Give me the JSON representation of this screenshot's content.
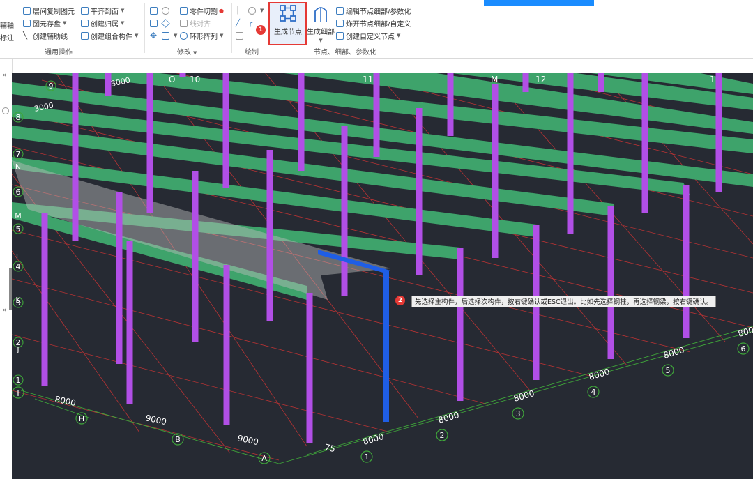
{
  "ribbon": {
    "general_ops": {
      "title": "通用操作",
      "left_cut_1": "辅轴",
      "left_cut_2": "标注",
      "layer_copy": "层间复制图元",
      "element_save": "图元存盘",
      "create_aux_line": "创建辅助线",
      "align_to_face": "平齐到面",
      "create_group": "创建归属",
      "create_combo": "创建组合构件"
    },
    "modify": {
      "title": "修改",
      "part_cut": "零件切割",
      "line_align": "线对齐",
      "ring_array": "环形阵列"
    },
    "draw": {
      "title": "绘制"
    },
    "node": {
      "title": "节点、细部、参数化",
      "gen_node": "生成节点",
      "gen_detail": "生成细部",
      "edit_node": "编辑节点细部/参数化",
      "explode_node": "炸开节点细部/自定义",
      "create_custom": "创建自定义节点"
    }
  },
  "steps": {
    "step1": "1",
    "step2": "2"
  },
  "tooltip": "先选择主构件，后选择次构件，按右键确认或ESC退出。比如先选择钢柱，再选择钢梁，按右键确认。",
  "colors": {
    "beam": "#3ea36b",
    "column": "#b14fe6",
    "selected": "#1f5ee6",
    "grid_x": "#d23a3a",
    "grid_y": "#4ab33f",
    "bg": "#262a33"
  },
  "axes": {
    "numbers": [
      "1",
      "2",
      "3",
      "4",
      "5",
      "6"
    ],
    "number_spacings": [
      "8000",
      "8000",
      "8000",
      "8000",
      "8000"
    ],
    "letters": [
      "A",
      "B",
      "H",
      "I"
    ],
    "letter_spacings": [
      "8000",
      "9000",
      "8000"
    ],
    "left_labels": [
      "1",
      "2",
      "3",
      "4",
      "5",
      "6",
      "7",
      "8",
      "9"
    ],
    "left_letters": [
      "I",
      "J",
      "K",
      "L",
      "M",
      "N"
    ],
    "top_labels": [
      "O",
      "10",
      "11",
      "M",
      "12",
      "1"
    ],
    "dim_75": "75",
    "dim_3000a": "3000",
    "dim_3000b": "3000"
  }
}
